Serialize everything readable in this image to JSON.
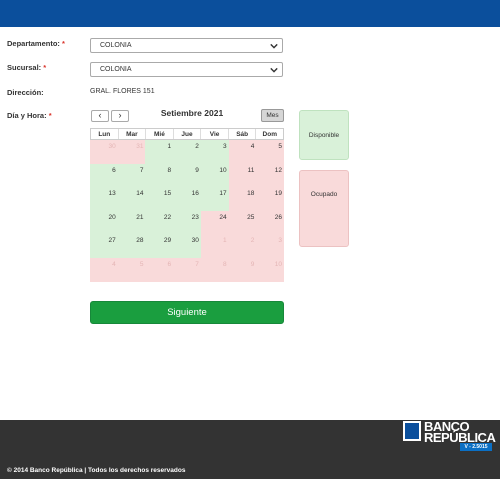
{
  "form": {
    "departamento": {
      "label": "Departamento:",
      "required": "*",
      "value": "COLONIA"
    },
    "sucursal": {
      "label": "Sucursal:",
      "required": "*",
      "value": "COLONIA"
    },
    "direccion": {
      "label": "Dirección:",
      "value": "GRAL. FLORES 151"
    },
    "dia_hora": {
      "label": "Día y Hora:",
      "required": "*"
    }
  },
  "calendar": {
    "prev": "‹",
    "next": "›",
    "title": "Setiembre 2021",
    "view_button": "Mes",
    "weekdays": [
      "Lun",
      "Mar",
      "Mié",
      "Jue",
      "Vie",
      "Sáb",
      "Dom"
    ],
    "weeks": [
      [
        {
          "d": "30",
          "s": "other"
        },
        {
          "d": "31",
          "s": "other"
        },
        {
          "d": "1",
          "s": "disp"
        },
        {
          "d": "2",
          "s": "disp"
        },
        {
          "d": "3",
          "s": "disp"
        },
        {
          "d": "4",
          "s": "ocup"
        },
        {
          "d": "5",
          "s": "ocup"
        }
      ],
      [
        {
          "d": "6",
          "s": "disp"
        },
        {
          "d": "7",
          "s": "disp"
        },
        {
          "d": "8",
          "s": "disp"
        },
        {
          "d": "9",
          "s": "disp"
        },
        {
          "d": "10",
          "s": "disp"
        },
        {
          "d": "11",
          "s": "ocup"
        },
        {
          "d": "12",
          "s": "ocup"
        }
      ],
      [
        {
          "d": "13",
          "s": "disp"
        },
        {
          "d": "14",
          "s": "disp"
        },
        {
          "d": "15",
          "s": "disp"
        },
        {
          "d": "16",
          "s": "disp"
        },
        {
          "d": "17",
          "s": "disp"
        },
        {
          "d": "18",
          "s": "ocup"
        },
        {
          "d": "19",
          "s": "ocup"
        }
      ],
      [
        {
          "d": "20",
          "s": "disp"
        },
        {
          "d": "21",
          "s": "disp"
        },
        {
          "d": "22",
          "s": "disp"
        },
        {
          "d": "23",
          "s": "disp"
        },
        {
          "d": "24",
          "s": "ocup"
        },
        {
          "d": "25",
          "s": "ocup"
        },
        {
          "d": "26",
          "s": "ocup"
        }
      ],
      [
        {
          "d": "27",
          "s": "disp"
        },
        {
          "d": "28",
          "s": "disp"
        },
        {
          "d": "29",
          "s": "disp"
        },
        {
          "d": "30",
          "s": "disp"
        },
        {
          "d": "1",
          "s": "other"
        },
        {
          "d": "2",
          "s": "other"
        },
        {
          "d": "3",
          "s": "other"
        }
      ],
      [
        {
          "d": "4",
          "s": "other"
        },
        {
          "d": "5",
          "s": "other"
        },
        {
          "d": "6",
          "s": "other"
        },
        {
          "d": "7",
          "s": "other"
        },
        {
          "d": "8",
          "s": "other"
        },
        {
          "d": "9",
          "s": "other"
        },
        {
          "d": "10",
          "s": "other"
        }
      ]
    ]
  },
  "legend": {
    "available": "Disponible",
    "busy": "Ocupado"
  },
  "actions": {
    "next_label": "Siguiente"
  },
  "footer": {
    "copyright": "© 2014 Banco República | Todos los derechos reservados",
    "logo_line1": "BANCO",
    "logo_line2": "REPÚBLICA",
    "version": "V - 2.5015"
  },
  "colors": {
    "header": "#0b4f9c",
    "available": "#d9f1d9",
    "busy": "#f9dada",
    "button": "#1a9e3f",
    "footer": "#333333"
  }
}
